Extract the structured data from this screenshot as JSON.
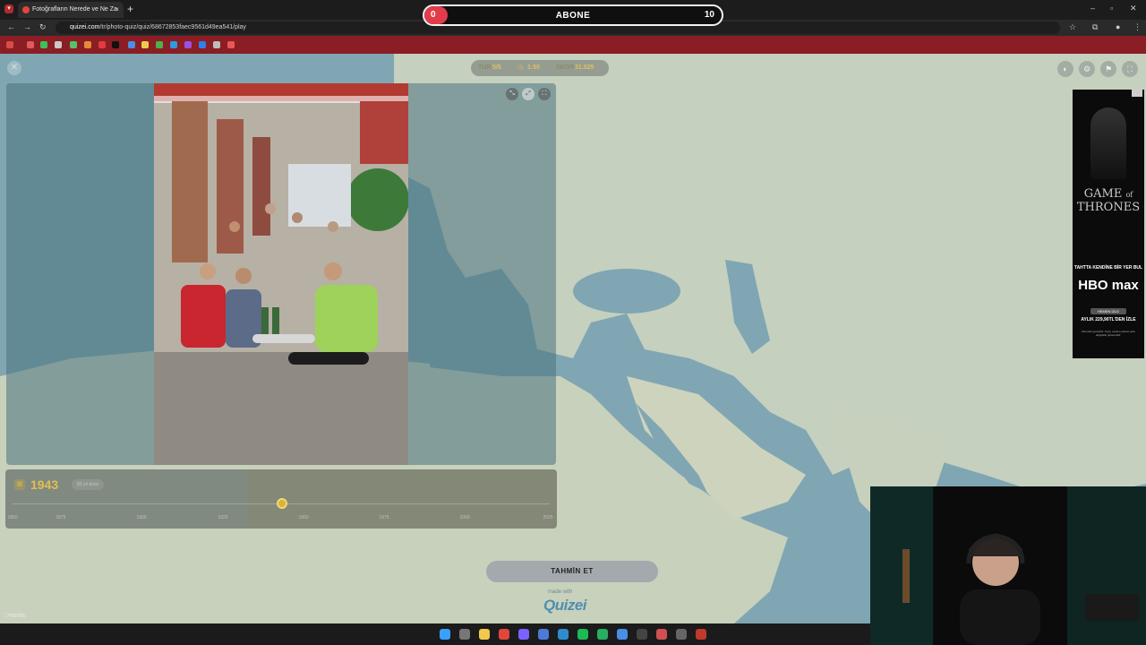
{
  "browser": {
    "tab_title": "Fotoğrafların Nerede ve Ne Za",
    "tab_close": "×",
    "new_tab": "+",
    "url_host": "quizei.com",
    "url_path": "/tr/photo-quiz/quiz/68672853faec9561d49ea541/play"
  },
  "overlay": {
    "current": "0",
    "label": "ABONE",
    "goal": "10"
  },
  "game": {
    "close_icon": "✕",
    "round_label": "TUR",
    "round_value": "5/5",
    "timer": "1:50",
    "score_label": "SKOR",
    "score_value": "31.025"
  },
  "timeline": {
    "selected_year": "1943",
    "diff_text": "83 yıl önce",
    "ticks": [
      "1860",
      "1875",
      "1900",
      "1925",
      "1950",
      "1975",
      "2000",
      "2025"
    ]
  },
  "actions": {
    "guess_label": "TAHMİN ET",
    "made_with": "made with",
    "logo_text": "Quizei",
    "map_attribution": "Harita"
  },
  "ad": {
    "title_line1": "GAME",
    "title_of": "of",
    "title_line2": "THRONES",
    "tagline": "TAHTTA KENDİNE BİR YER BUL",
    "brand": "HBO max",
    "cta": "HEMEN İZLE",
    "price": "AYLIK 229,90TL'DEN İZLE",
    "fine_print": "Abonelik gereklidir. Fiyat, seçilen pakete göre değişiklik gösterebilir."
  },
  "colors": {
    "sea": "#7fa6b2",
    "land": "#c5d0bf",
    "accent_gold": "#e2bf4f",
    "overlay_red": "#e23c4a"
  }
}
